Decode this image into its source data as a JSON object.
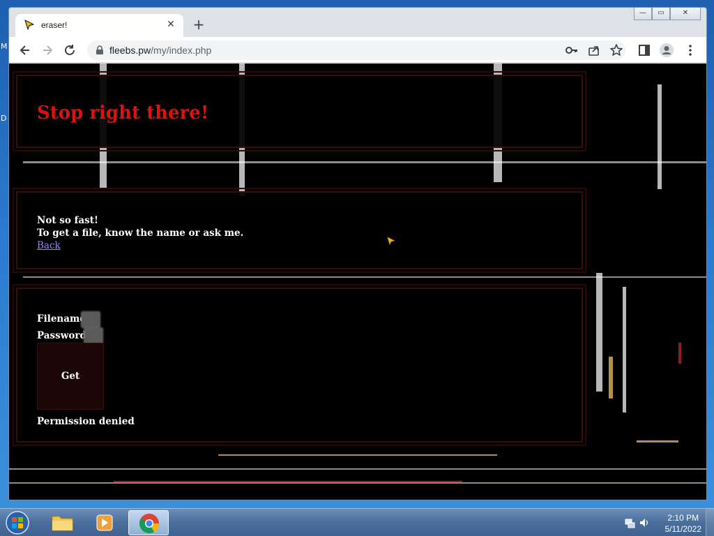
{
  "desktop": {
    "fragment_1": "M",
    "fragment_2": "D"
  },
  "browser": {
    "tab_title": "eraser!",
    "new_tab_symbol": "+",
    "tab_close_symbol": "✕",
    "window_buttons": {
      "minimize": "—",
      "maximize": "▭",
      "close": "✕"
    },
    "url_host": "fleebs.pw",
    "url_path": "/my/index.php"
  },
  "page": {
    "heading": "Stop right there!",
    "message_line_1": "Not so fast!",
    "message_line_2": "To get a file, know the name or ask me.",
    "back_link": "Back",
    "filename_label": "Filename:",
    "password_label": "Password:",
    "get_button": "Get",
    "status": "Permission denied"
  },
  "taskbar": {
    "time": "2:10 PM",
    "date": "5/11/2022"
  },
  "colors": {
    "heading": "#e01010",
    "link": "#8b8bff",
    "panel_border": "#3a0d0d",
    "button_bg": "#1c0606"
  }
}
